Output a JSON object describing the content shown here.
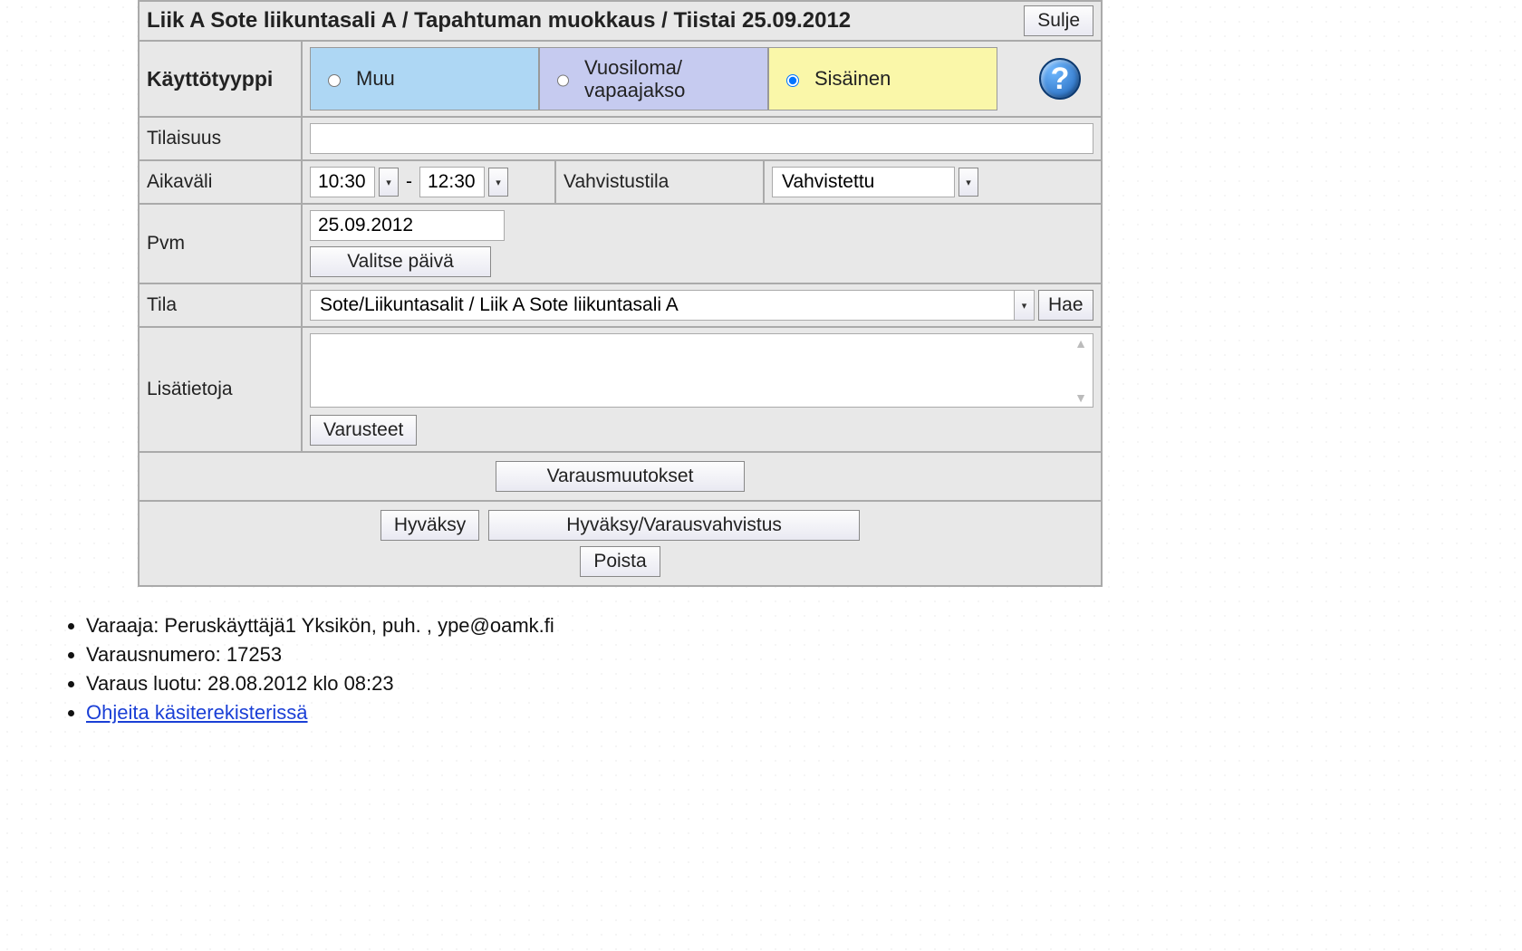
{
  "header": {
    "title": "Liik A Sote liikuntasali A / Tapahtuman muokkaus / Tiistai 25.09.2012",
    "close_label": "Sulje"
  },
  "rows": {
    "type_label": "Käyttötyyppi",
    "type_options": {
      "muu": "Muu",
      "vuosiloma": "Vuosiloma/ vapaajakso",
      "sisainen": "Sisäinen"
    },
    "event_label": "Tilaisuus",
    "event_value": "",
    "time_label": "Aikaväli",
    "time_start": "10:30",
    "time_end": "12:30",
    "status_label": "Vahvistustila",
    "status_value": "Vahvistettu",
    "date_label": "Pvm",
    "date_value": "25.09.2012",
    "pick_date_label": "Valitse päivä",
    "room_label": "Tila",
    "room_value": "Sote/Liikuntasalit / Liik A Sote liikuntasali A",
    "search_label": "Hae",
    "extra_label": "Lisätietoja",
    "extra_value": "",
    "equipment_label": "Varusteet"
  },
  "actions": {
    "changes": "Varausmuutokset",
    "approve": "Hyväksy",
    "approve_confirm": "Hyväksy/Varausvahvistus",
    "delete": "Poista"
  },
  "info": {
    "reserver": "Varaaja: Peruskäyttäjä1 Yksikön, puh. , ype@oamk.fi",
    "number": "Varausnumero: 17253",
    "created": "Varaus luotu: 28.08.2012 klo 08:23",
    "help_link": "Ohjeita käsiterekisterissä"
  }
}
